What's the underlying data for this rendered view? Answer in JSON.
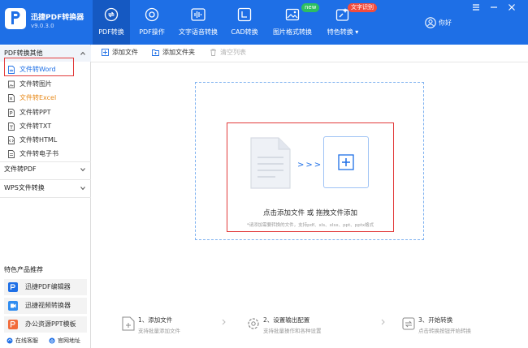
{
  "app": {
    "title": "迅捷PDF转换器",
    "version": "v9.0.3.0"
  },
  "nav": [
    {
      "label": "PDF转换",
      "icon": "convert-icon"
    },
    {
      "label": "PDF操作",
      "icon": "pdf-ops-icon"
    },
    {
      "label": "文字语音转换",
      "icon": "audio-wave-icon"
    },
    {
      "label": "CAD转换",
      "icon": "cad-icon"
    },
    {
      "label": "图片格式转换",
      "icon": "image-icon"
    },
    {
      "label": "特色转换",
      "icon": "magic-icon"
    }
  ],
  "badges": {
    "new": "new",
    "hot": "文字识别"
  },
  "user": {
    "label": "你好"
  },
  "sidebar": {
    "group1": "PDF转换其他",
    "items": [
      {
        "label": "文件转Word"
      },
      {
        "label": "文件转图片"
      },
      {
        "label": "文件转Excel"
      },
      {
        "label": "文件转PPT"
      },
      {
        "label": "文件转TXT"
      },
      {
        "label": "文件转HTML"
      },
      {
        "label": "文件转电子书"
      }
    ],
    "group2": "文件转PDF",
    "group3": "WPS文件转换",
    "feature_title": "特色产品推荐",
    "features": [
      {
        "label": "迅捷PDF编辑器"
      },
      {
        "label": "迅捷视频转换器"
      },
      {
        "label": "办公资源PPT模板"
      }
    ],
    "footer": {
      "service": "在线客服",
      "website": "官网地址"
    }
  },
  "toolbar": {
    "add_file": "添加文件",
    "add_folder": "添加文件夹",
    "clear": "清空列表"
  },
  "dropzone": {
    "main_text": "点击添加文件 或 拖拽文件添加",
    "hint": "*请添加需要转换的文件，支持pdf、xls、xlsx、ppt、pptx格式"
  },
  "steps": [
    {
      "title": "1、添加文件",
      "sub": "支持批量添加文件"
    },
    {
      "title": "2、设置输出配置",
      "sub": "支持批量操作和各种设置"
    },
    {
      "title": "3、开始转换",
      "sub": "点击转换按钮开始转换"
    }
  ],
  "colors": {
    "brand": "#1E6FE6",
    "active_nav": "#1559C2",
    "highlight": "#E23B3B",
    "orange": "#E88A1A"
  }
}
